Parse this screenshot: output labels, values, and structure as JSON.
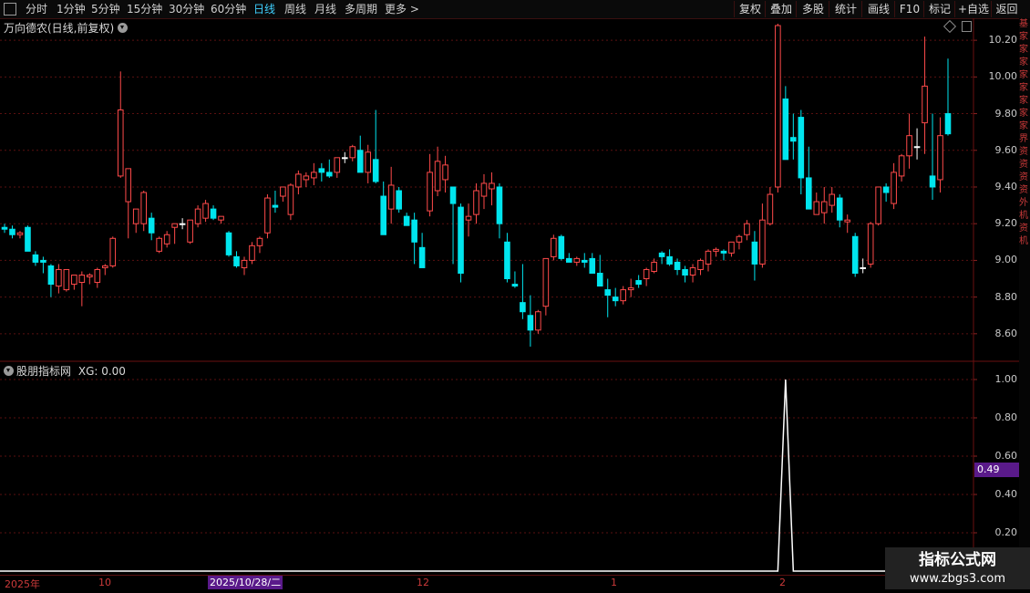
{
  "toolbar": {
    "periods": [
      "分时",
      "1分钟",
      "5分钟",
      "15分钟",
      "30分钟",
      "60分钟",
      "日线",
      "周线",
      "月线",
      "多周期",
      "更多 >"
    ],
    "active_period": "日线",
    "actions": [
      "复权",
      "叠加",
      "多股",
      "统计",
      "画线",
      "F10",
      "标记",
      "+自选",
      "返回"
    ]
  },
  "main_panel": {
    "title": "万向德农(日线,前复权)",
    "y_ticks": [
      "10.20",
      "10.00",
      "9.80",
      "9.60",
      "9.40",
      "9.20",
      "9.00",
      "8.80",
      "8.60"
    ]
  },
  "sub_panel": {
    "title": "股朋指标网",
    "indicator": "XG: 0.00",
    "y_ticks": [
      "1.00",
      "0.80",
      "0.60",
      "0.40",
      "0.20"
    ],
    "current_value": "0.49"
  },
  "time_axis": {
    "labels": [
      "2025年",
      "10",
      "2025/10/28/二",
      "12",
      "1",
      "2"
    ]
  },
  "watermark": {
    "line1": "指标公式网",
    "line2": "www.zbgs3.com"
  },
  "side_strip_text": "基家家家家家家家家界资资资资外机资机",
  "colors": {
    "up": "#ff4a4a",
    "down": "#00e5ee",
    "doji": "#ffffff",
    "grid": "#5a1010",
    "bg": "#000000"
  },
  "chart_data": {
    "type": "candlestick",
    "ylim": [
      8.45,
      10.32
    ],
    "candles": [
      [
        9.18,
        9.2,
        9.15,
        9.17
      ],
      [
        9.17,
        9.19,
        9.12,
        9.14
      ],
      [
        9.14,
        9.16,
        9.12,
        9.15
      ],
      [
        9.18,
        9.19,
        9.06,
        9.05
      ],
      [
        9.03,
        9.05,
        8.97,
        8.99
      ],
      [
        9.0,
        9.02,
        8.93,
        8.99
      ],
      [
        8.97,
        8.98,
        8.8,
        8.87
      ],
      [
        8.86,
        8.98,
        8.82,
        8.95
      ],
      [
        8.84,
        8.92,
        8.83,
        8.95
      ],
      [
        8.87,
        8.9,
        8.84,
        8.92
      ],
      [
        8.88,
        8.94,
        8.75,
        8.92
      ],
      [
        8.91,
        8.93,
        8.87,
        8.92
      ],
      [
        8.88,
        8.96,
        8.85,
        8.95
      ],
      [
        8.96,
        8.98,
        8.92,
        8.97
      ],
      [
        8.97,
        9.13,
        8.96,
        9.12
      ],
      [
        9.46,
        10.03,
        9.45,
        9.82
      ],
      [
        9.32,
        9.48,
        9.12,
        9.5
      ],
      [
        9.2,
        9.27,
        9.15,
        9.28
      ],
      [
        9.2,
        9.38,
        9.16,
        9.37
      ],
      [
        9.23,
        9.26,
        9.11,
        9.15
      ],
      [
        9.05,
        9.13,
        9.04,
        9.12
      ],
      [
        9.09,
        9.16,
        9.07,
        9.14
      ],
      [
        9.18,
        9.2,
        9.09,
        9.2
      ],
      [
        9.2,
        9.23,
        9.17,
        9.2
      ],
      [
        9.1,
        9.22,
        9.09,
        9.22
      ],
      [
        9.2,
        9.3,
        9.18,
        9.28
      ],
      [
        9.23,
        9.33,
        9.21,
        9.31
      ],
      [
        9.28,
        9.3,
        9.22,
        9.23
      ],
      [
        9.22,
        9.24,
        9.2,
        9.24
      ],
      [
        9.15,
        9.16,
        9.02,
        9.03
      ],
      [
        9.02,
        9.05,
        8.96,
        8.97
      ],
      [
        8.96,
        9.02,
        8.92,
        9.0
      ],
      [
        9.0,
        9.1,
        8.98,
        9.08
      ],
      [
        9.08,
        9.13,
        9.04,
        9.12
      ],
      [
        9.15,
        9.36,
        9.12,
        9.34
      ],
      [
        9.3,
        9.38,
        9.26,
        9.29
      ],
      [
        9.35,
        9.4,
        9.32,
        9.4
      ],
      [
        9.25,
        9.42,
        9.22,
        9.41
      ],
      [
        9.4,
        9.49,
        9.36,
        9.47
      ],
      [
        9.44,
        9.48,
        9.4,
        9.46
      ],
      [
        9.45,
        9.53,
        9.41,
        9.48
      ],
      [
        9.5,
        9.53,
        9.43,
        9.48
      ],
      [
        9.48,
        9.55,
        9.45,
        9.46
      ],
      [
        9.48,
        9.56,
        9.45,
        9.56
      ],
      [
        9.56,
        9.59,
        9.53,
        9.56
      ],
      [
        9.56,
        9.63,
        9.54,
        9.62
      ],
      [
        9.6,
        9.68,
        9.5,
        9.48
      ],
      [
        9.48,
        9.63,
        9.42,
        9.59
      ],
      [
        9.55,
        9.82,
        9.42,
        9.43
      ],
      [
        9.35,
        9.43,
        9.15,
        9.14
      ],
      [
        9.28,
        9.51,
        9.2,
        9.41
      ],
      [
        9.38,
        9.4,
        9.26,
        9.28
      ],
      [
        9.24,
        9.26,
        9.19,
        9.19
      ],
      [
        9.22,
        9.26,
        8.98,
        9.1
      ],
      [
        9.07,
        9.15,
        9.02,
        8.96
      ],
      [
        9.27,
        9.58,
        9.24,
        9.48
      ],
      [
        9.38,
        9.62,
        9.35,
        9.54
      ],
      [
        9.44,
        9.57,
        9.37,
        9.52
      ],
      [
        9.4,
        9.4,
        8.98,
        9.31
      ],
      [
        9.29,
        9.31,
        8.88,
        8.93
      ],
      [
        9.22,
        9.31,
        9.13,
        9.24
      ],
      [
        9.25,
        9.42,
        9.2,
        9.38
      ],
      [
        9.35,
        9.47,
        9.28,
        9.42
      ],
      [
        9.39,
        9.48,
        9.3,
        9.42
      ],
      [
        9.4,
        9.42,
        9.12,
        9.2
      ],
      [
        9.1,
        9.15,
        8.88,
        8.9
      ],
      [
        8.87,
        8.94,
        8.85,
        8.86
      ],
      [
        8.77,
        8.98,
        8.68,
        8.72
      ],
      [
        8.7,
        8.81,
        8.53,
        8.62
      ],
      [
        8.62,
        8.73,
        8.6,
        8.72
      ],
      [
        8.75,
        8.98,
        8.7,
        9.01
      ],
      [
        9.02,
        9.14,
        9.0,
        9.12
      ],
      [
        9.13,
        9.14,
        9.0,
        9.01
      ],
      [
        9.01,
        9.04,
        8.99,
        8.99
      ],
      [
        8.99,
        9.02,
        8.97,
        9.01
      ],
      [
        9.0,
        9.04,
        8.96,
        8.99
      ],
      [
        9.01,
        9.04,
        8.95,
        8.93
      ],
      [
        8.93,
        9.03,
        8.88,
        8.86
      ],
      [
        8.84,
        8.9,
        8.69,
        8.81
      ],
      [
        8.8,
        8.85,
        8.75,
        8.78
      ],
      [
        8.78,
        8.86,
        8.76,
        8.84
      ],
      [
        8.84,
        8.9,
        8.8,
        8.85
      ],
      [
        8.89,
        8.92,
        8.85,
        8.87
      ],
      [
        8.9,
        8.96,
        8.86,
        8.95
      ],
      [
        8.94,
        9.01,
        8.93,
        8.99
      ],
      [
        9.04,
        9.05,
        8.98,
        9.02
      ],
      [
        9.02,
        9.06,
        8.97,
        8.98
      ],
      [
        8.99,
        9.01,
        8.92,
        8.95
      ],
      [
        8.95,
        8.97,
        8.88,
        8.92
      ],
      [
        8.92,
        8.98,
        8.88,
        8.96
      ],
      [
        8.95,
        9.01,
        8.92,
        9.0
      ],
      [
        8.98,
        9.06,
        8.94,
        9.05
      ],
      [
        9.05,
        9.07,
        9.02,
        9.06
      ],
      [
        9.05,
        9.06,
        9.0,
        9.04
      ],
      [
        9.04,
        9.1,
        9.02,
        9.1
      ],
      [
        9.1,
        9.14,
        9.06,
        9.13
      ],
      [
        9.14,
        9.22,
        9.11,
        9.2
      ],
      [
        9.1,
        9.16,
        8.89,
        8.98
      ],
      [
        8.98,
        9.31,
        8.96,
        9.22
      ],
      [
        9.2,
        9.4,
        9.19,
        9.36
      ],
      [
        9.4,
        10.29,
        9.37,
        10.28
      ],
      [
        9.88,
        9.95,
        9.56,
        9.55
      ],
      [
        9.67,
        9.8,
        9.55,
        9.65
      ],
      [
        9.78,
        9.82,
        9.36,
        9.45
      ],
      [
        9.45,
        9.62,
        9.3,
        9.28
      ],
      [
        9.25,
        9.37,
        9.25,
        9.32
      ],
      [
        9.26,
        9.4,
        9.2,
        9.32
      ],
      [
        9.3,
        9.4,
        9.26,
        9.36
      ],
      [
        9.34,
        9.36,
        9.18,
        9.22
      ],
      [
        9.21,
        9.25,
        9.15,
        9.22
      ],
      [
        9.13,
        9.15,
        8.91,
        8.93
      ],
      [
        8.96,
        9.01,
        8.93,
        8.96
      ],
      [
        8.98,
        9.21,
        8.96,
        9.2
      ],
      [
        9.2,
        9.4,
        9.19,
        9.4
      ],
      [
        9.4,
        9.42,
        9.32,
        9.37
      ],
      [
        9.31,
        9.53,
        9.28,
        9.48
      ],
      [
        9.46,
        9.58,
        9.43,
        9.57
      ],
      [
        9.57,
        9.8,
        9.5,
        9.68
      ],
      [
        9.62,
        9.72,
        9.55,
        9.62
      ],
      [
        9.75,
        10.22,
        9.58,
        9.95
      ],
      [
        9.46,
        9.8,
        9.33,
        9.4
      ],
      [
        9.44,
        9.78,
        9.37,
        9.68
      ],
      [
        9.8,
        10.1,
        9.68,
        9.69
      ]
    ],
    "xg_series_peak_index": 101,
    "xg_peak": 1.0
  }
}
